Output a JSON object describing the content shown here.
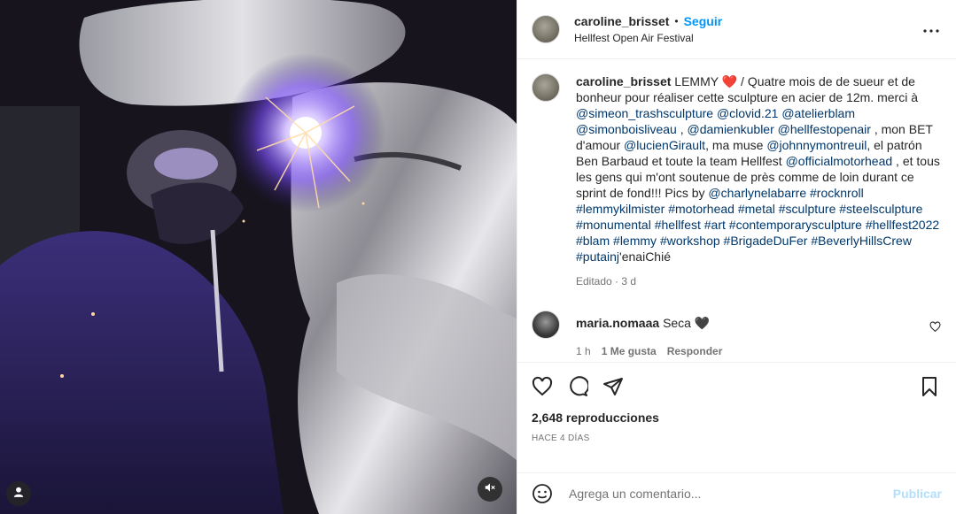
{
  "post": {
    "username": "caroline_brisset",
    "follow_label": "Seguir",
    "separator": "•",
    "location": "Hellfest Open Air Festival",
    "more_icon": "more-horizontal-icon"
  },
  "media": {
    "user_icon": "user-tag-icon",
    "mute_icon": "sound-off-icon"
  },
  "caption": {
    "username": "caroline_brisset",
    "segments": [
      {
        "t": "LEMMY ",
        "k": "text"
      },
      {
        "t": "❤️",
        "k": "heart"
      },
      {
        "t": " / Quatre mois de de sueur et de bonheur pour réaliser cette sculpture en acier de 12m. merci à ",
        "k": "text"
      },
      {
        "t": "@simeon_trashsculpture",
        "k": "tag"
      },
      {
        "t": " ",
        "k": "text"
      },
      {
        "t": "@clovid.21",
        "k": "tag"
      },
      {
        "t": " ",
        "k": "text"
      },
      {
        "t": "@atelierblam",
        "k": "tag"
      },
      {
        "t": " ",
        "k": "text"
      },
      {
        "t": "@simonboisliveau",
        "k": "tag"
      },
      {
        "t": " , ",
        "k": "text"
      },
      {
        "t": "@damienkubler",
        "k": "tag"
      },
      {
        "t": " ",
        "k": "text"
      },
      {
        "t": "@hellfestopenair",
        "k": "tag"
      },
      {
        "t": " , mon BET d'amour ",
        "k": "text"
      },
      {
        "t": "@lucienGirault",
        "k": "tag"
      },
      {
        "t": ", ma muse ",
        "k": "text"
      },
      {
        "t": "@johnnymontreuil",
        "k": "tag"
      },
      {
        "t": ", el patrón Ben Barbaud et toute la team Hellfest ",
        "k": "text"
      },
      {
        "t": "@officialmotorhead",
        "k": "tag"
      },
      {
        "t": " , et tous les gens qui m'ont soutenue de près comme de loin durant ce sprint de fond!!! Pics by ",
        "k": "text"
      },
      {
        "t": "@charlynelabarre",
        "k": "tag"
      },
      {
        "t": " ",
        "k": "text"
      },
      {
        "t": "#rocknroll",
        "k": "tag"
      },
      {
        "t": " ",
        "k": "text"
      },
      {
        "t": "#lemmykilmister",
        "k": "tag"
      },
      {
        "t": " ",
        "k": "text"
      },
      {
        "t": "#motorhead",
        "k": "tag"
      },
      {
        "t": " ",
        "k": "text"
      },
      {
        "t": "#metal",
        "k": "tag"
      },
      {
        "t": " ",
        "k": "text"
      },
      {
        "t": "#sculpture",
        "k": "tag"
      },
      {
        "t": " ",
        "k": "text"
      },
      {
        "t": "#steelsculpture",
        "k": "tag"
      },
      {
        "t": " ",
        "k": "text"
      },
      {
        "t": "#monumental",
        "k": "tag"
      },
      {
        "t": " ",
        "k": "text"
      },
      {
        "t": "#hellfest",
        "k": "tag"
      },
      {
        "t": " ",
        "k": "text"
      },
      {
        "t": "#art",
        "k": "tag"
      },
      {
        "t": " ",
        "k": "text"
      },
      {
        "t": "#contemporarysculpture",
        "k": "tag"
      },
      {
        "t": " ",
        "k": "text"
      },
      {
        "t": "#hellfest2022",
        "k": "tag"
      },
      {
        "t": " ",
        "k": "text"
      },
      {
        "t": "#blam",
        "k": "tag"
      },
      {
        "t": " ",
        "k": "text"
      },
      {
        "t": "#lemmy",
        "k": "tag"
      },
      {
        "t": " ",
        "k": "text"
      },
      {
        "t": "#workshop",
        "k": "tag"
      },
      {
        "t": " ",
        "k": "text"
      },
      {
        "t": "#BrigadeDuFer",
        "k": "tag"
      },
      {
        "t": " ",
        "k": "text"
      },
      {
        "t": "#BeverlyHillsCrew",
        "k": "tag"
      },
      {
        "t": " ",
        "k": "text"
      },
      {
        "t": "#putainj",
        "k": "tag"
      },
      {
        "t": "'enaiChié",
        "k": "text"
      }
    ],
    "meta": "Editado · 3 d"
  },
  "comment": {
    "username": "maria.nomaaa",
    "text": "Seca 🖤",
    "time": "1 h",
    "likes": "1 Me gusta",
    "reply": "Responder",
    "like_icon": "heart-outline-small-icon"
  },
  "actions": {
    "like_icon": "heart-outline-icon",
    "comment_icon": "comment-bubble-icon",
    "share_icon": "paper-plane-icon",
    "save_icon": "bookmark-icon",
    "views": "2,648 reproducciones",
    "posted": "HACE 4 DÍAS"
  },
  "composer": {
    "emoji_icon": "emoji-smiley-icon",
    "placeholder": "Agrega un comentario...",
    "publish_label": "Publicar"
  },
  "colors": {
    "link": "#00376b",
    "accent": "#0095f6",
    "publish_disabled": "#b2dffc",
    "secondary_text": "#737373"
  }
}
